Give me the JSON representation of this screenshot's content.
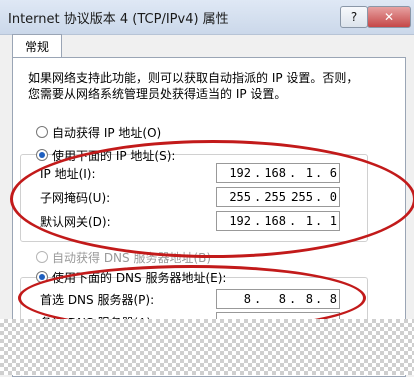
{
  "window": {
    "title": "Internet 协议版本 4 (TCP/IPv4) 属性",
    "help_label": "?",
    "close_label": "✕"
  },
  "tab": {
    "label": "常规"
  },
  "description": "如果网络支持此功能，则可以获取自动指派的 IP 设置。否则，您需要从网络系统管理员处获得适当的 IP 设置。",
  "ip": {
    "auto_label": "自动获得 IP 地址(O)",
    "manual_label": "使用下面的 IP 地址(S):",
    "fields": [
      {
        "label": "IP 地址(I):",
        "value": [
          "192",
          "168",
          "1",
          "6"
        ]
      },
      {
        "label": "子网掩码(U):",
        "value": [
          "255",
          "255",
          "255",
          "0"
        ]
      },
      {
        "label": "默认网关(D):",
        "value": [
          "192",
          "168",
          "1",
          "1"
        ]
      }
    ]
  },
  "dns": {
    "auto_label": "自动获得 DNS 服务器地址(B)",
    "manual_label": "使用下面的 DNS 服务器地址(E):",
    "fields": [
      {
        "label": "首选 DNS 服务器(P):",
        "value": [
          "8",
          "8",
          "8",
          "8"
        ]
      },
      {
        "label": "备用 DNS 服务器(A):",
        "value": [
          "",
          "",
          "",
          ""
        ]
      }
    ]
  },
  "annotation_color": "#c21a1a"
}
